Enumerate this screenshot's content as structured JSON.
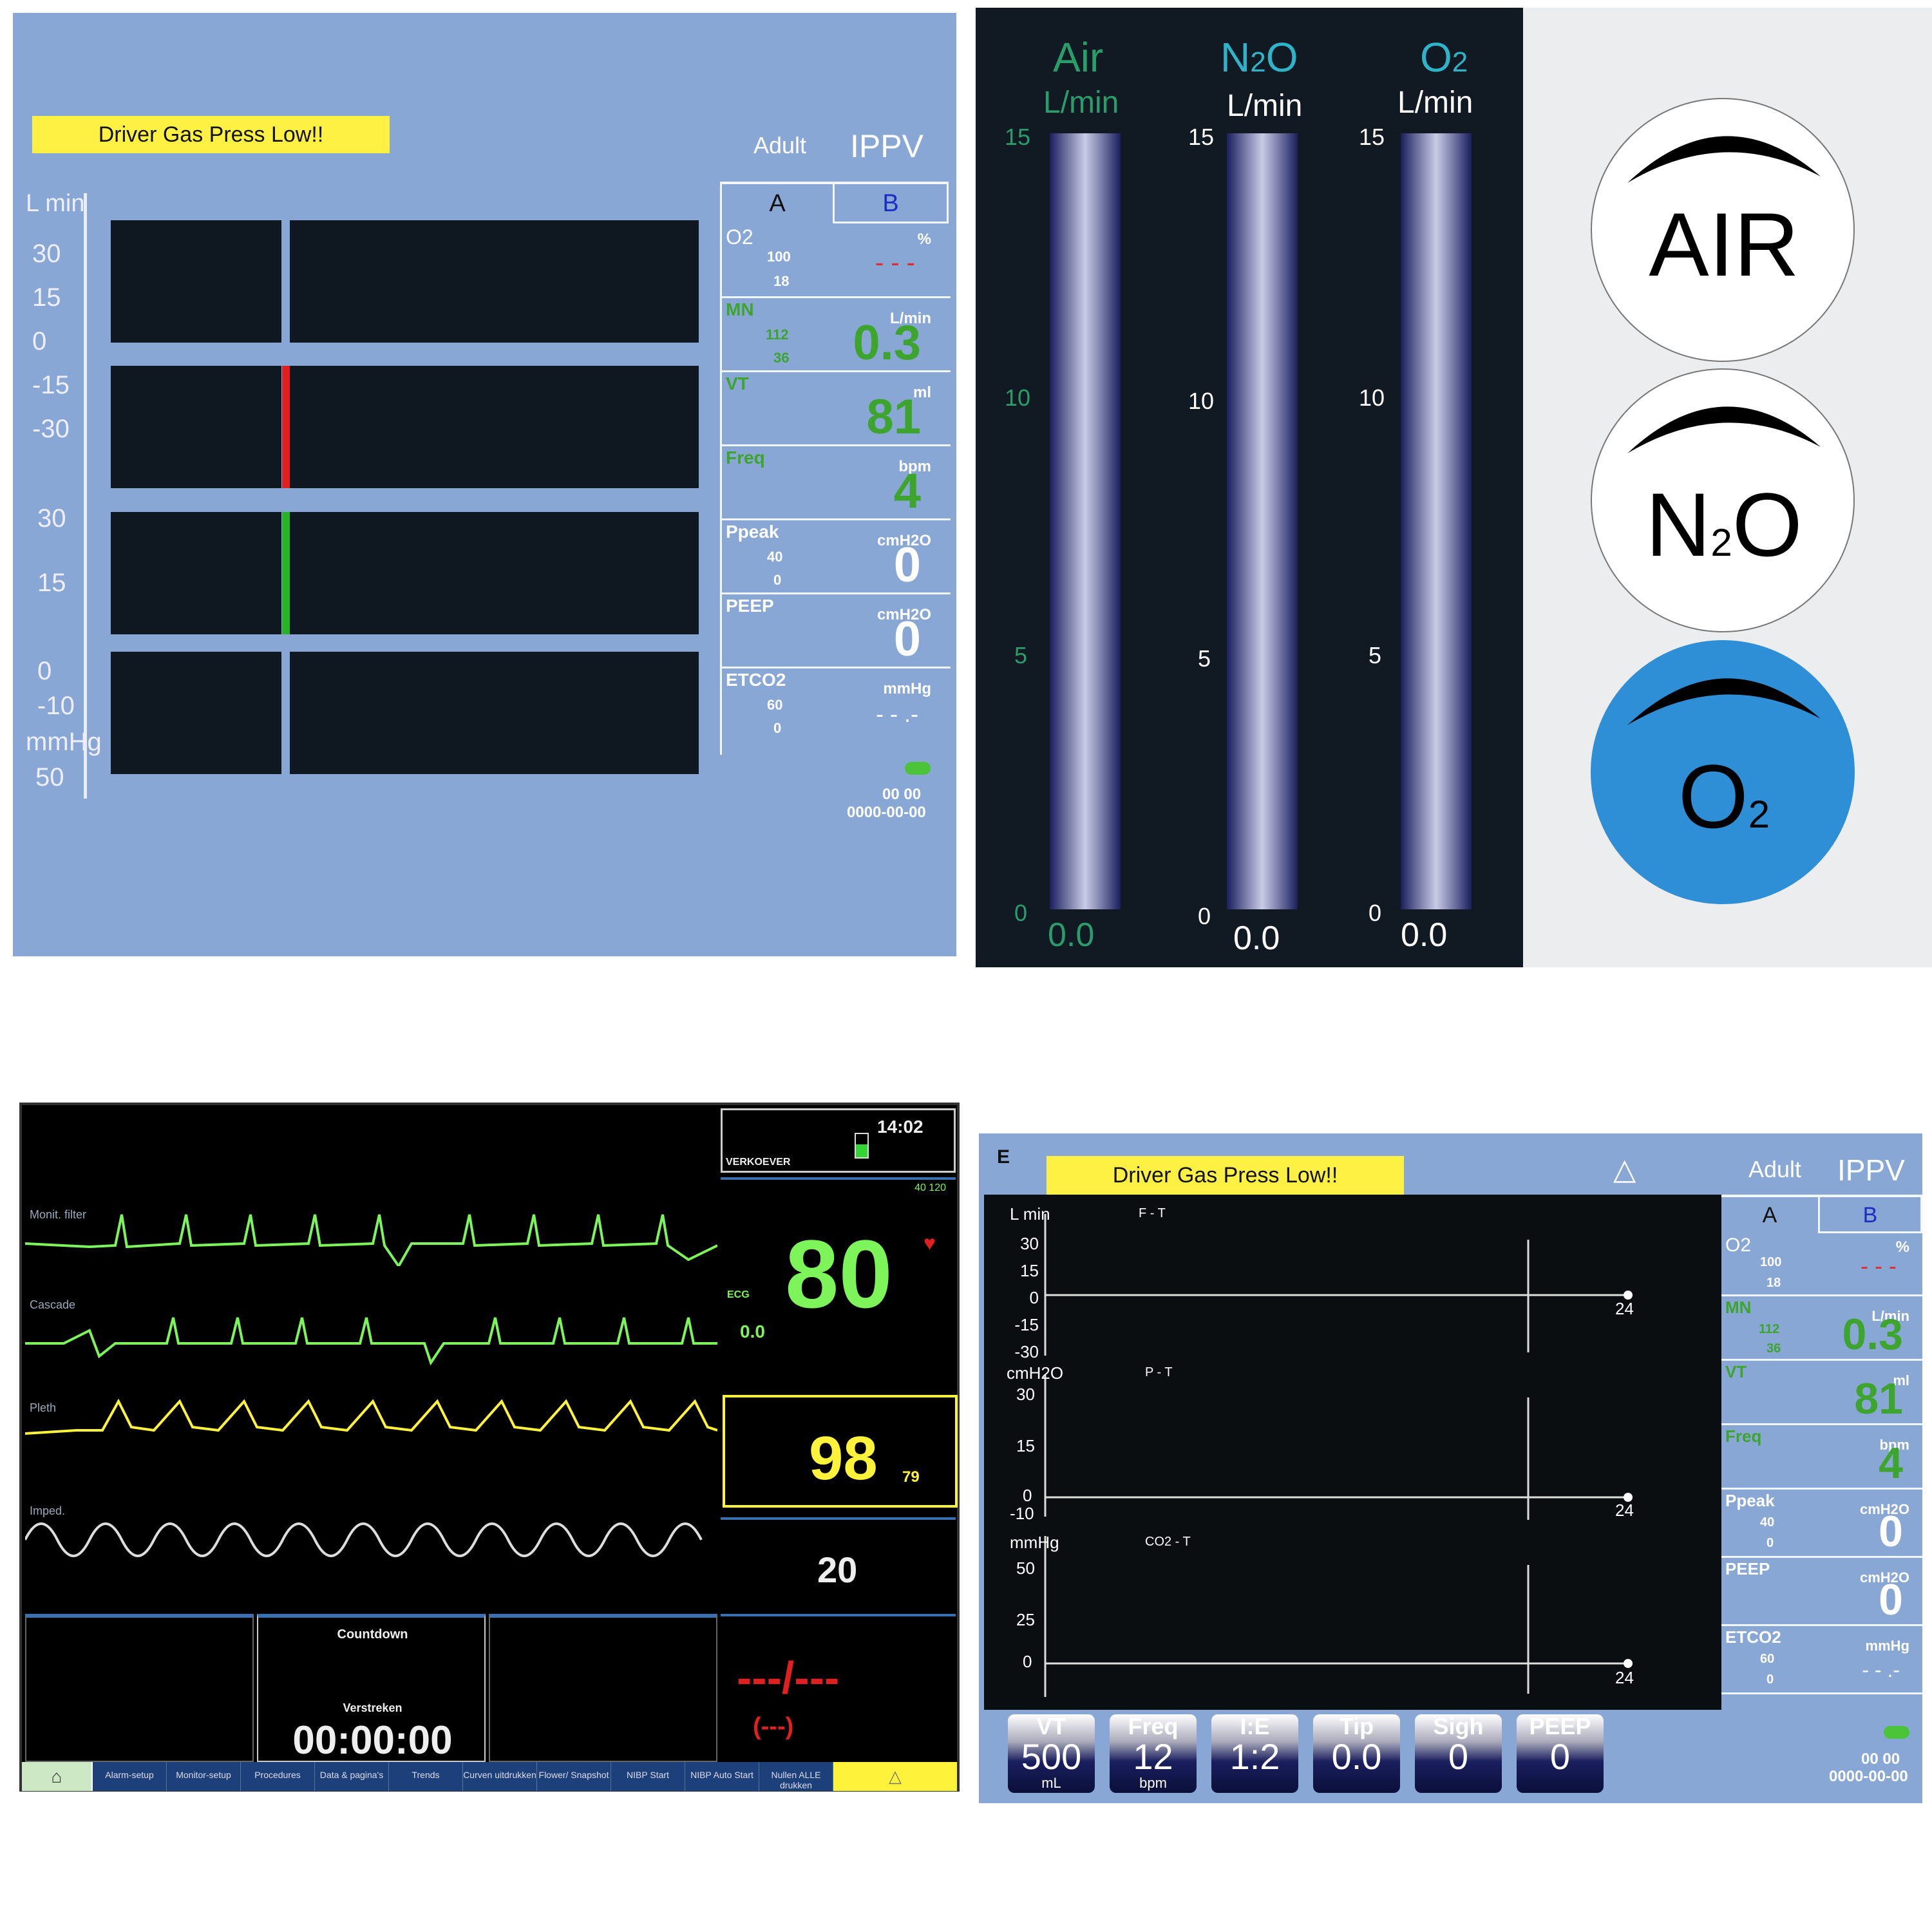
{
  "vent1": {
    "alarm": "Driver Gas Press Low!!",
    "patient": "Adult",
    "mode": "IPPV",
    "tab_a": "A",
    "tab_b": "B",
    "scale": {
      "unit1": "L min",
      "t1": [
        "30",
        "15",
        "0",
        "-15",
        "-30"
      ],
      "t2": [
        "30",
        "15",
        "0",
        "-10"
      ],
      "unit3": "mmHg",
      "t3": "50"
    },
    "params": {
      "o2": "O2",
      "o2_unit": "%",
      "o2_hi": "100",
      "o2_lo": "18",
      "o2_val": "- - -",
      "mn": "MN",
      "mn_unit": "L/min",
      "mn_hi": "112",
      "mn_lo": "36",
      "mn_val": "0.3",
      "vt": "VT",
      "vt_unit": "ml",
      "vt_val": "81",
      "freq": "Freq",
      "freq_unit": "bpm",
      "freq_val": "4",
      "ppeak": "Ppeak",
      "ppeak_unit": "cmH2O",
      "ppeak_hi": "40",
      "ppeak_lo": "0",
      "ppeak_val": "0",
      "peep": "PEEP",
      "peep_unit": "cmH2O",
      "peep_val": "0",
      "etco2": "ETCO2",
      "etco2_unit": "mmHg",
      "etco2_hi": "60",
      "etco2_lo": "0",
      "etco2_val": "- - .-"
    },
    "time": "00 00",
    "date": "0000-00-00"
  },
  "flow": {
    "air": "Air",
    "n2o": "N2O",
    "o2": "O2",
    "unit": "L/min",
    "ticks": [
      "15",
      "10",
      "5",
      "0"
    ],
    "air_val": "0.0",
    "n2o_val": "0.0",
    "o2_val": "0.0"
  },
  "knobs": {
    "air": "AIR",
    "n2o": "N2O",
    "o2": "O2",
    "colors": {
      "o2": "#2e8fd6"
    }
  },
  "monitor": {
    "time": "14:02",
    "bed": "VERKOEVER",
    "hr": "80",
    "hr_range": "40 120",
    "st_label": "ECG",
    "st_val": "0.0",
    "spo2": "98",
    "pr": "79",
    "resp": "20",
    "countdown": "Countdown",
    "countdown_sub": "Verstreken",
    "timer": "00:00:00",
    "nibp": "---/---",
    "nibp_map": "(---)",
    "wave1": "Monit. filter",
    "wave2": "Cascade",
    "wave3": "Pleth",
    "wave4": "Imped.",
    "footer": [
      "Alarm-setup",
      "Monitor-setup",
      "Procedures",
      "Data & pagina's",
      "Trends",
      "Curven uitdrukken",
      "Flower/ Snapshot",
      "NIBP Start",
      "NIBP Auto Start",
      "Nullen ALLE drukken"
    ]
  },
  "vent2": {
    "e": "E",
    "alarm": "Driver Gas Press Low!!",
    "patient": "Adult",
    "mode": "IPPV",
    "tab_a": "A",
    "tab_b": "B",
    "g1": {
      "unit": "L min",
      "title": "F - T",
      "ticks": [
        "30",
        "15",
        "0",
        "-15",
        "-30"
      ],
      "end": "24"
    },
    "g2": {
      "unit": "cmH2O",
      "title": "P - T",
      "ticks": [
        "30",
        "15",
        "0",
        "-10"
      ],
      "end": "24"
    },
    "g3": {
      "unit": "mmHg",
      "title": "CO2 - T",
      "ticks": [
        "50",
        "25",
        "0"
      ],
      "end": "24"
    },
    "settings": [
      {
        "label": "VT",
        "value": "500",
        "unit": "mL"
      },
      {
        "label": "Freq",
        "value": "12",
        "unit": "bpm"
      },
      {
        "label": "I:E",
        "value": "1:2",
        "unit": ""
      },
      {
        "label": "Tip",
        "value": "0.0",
        "unit": ""
      },
      {
        "label": "Sigh",
        "value": "0",
        "unit": ""
      },
      {
        "label": "PEEP",
        "value": "0",
        "unit": ""
      }
    ],
    "time": "00 00",
    "date": "0000-00-00"
  },
  "colors": {
    "vent_bg": "#88a7d4",
    "alarm": "#fff144",
    "value_green": "#3da52e",
    "flow_bg": "#111922",
    "mon_green": "#7df45a",
    "mon_yellow": "#fff23a"
  }
}
